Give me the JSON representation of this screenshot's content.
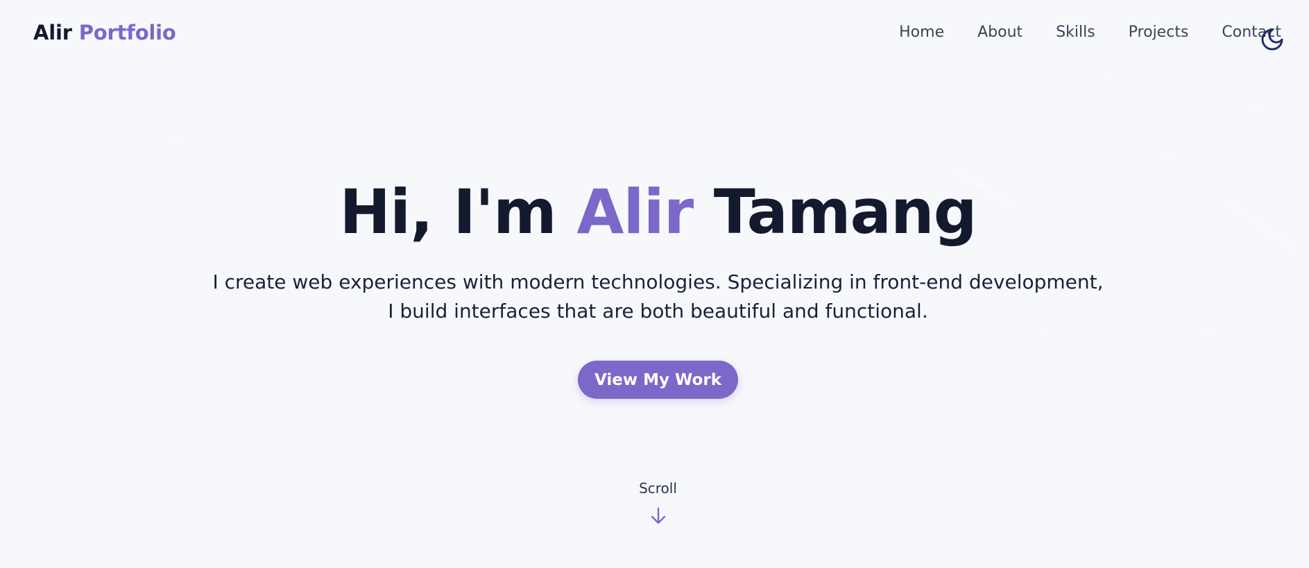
{
  "header": {
    "logo_main": "Alir",
    "logo_accent": "Portfolio",
    "nav": [
      "Home",
      "About",
      "Skills",
      "Projects",
      "Contact"
    ],
    "theme_toggle_icon": "moon-icon"
  },
  "hero": {
    "title_prefix": "Hi, I'm",
    "title_accent": "Alir",
    "title_suffix": "Tamang",
    "subtitle": "I create web experiences with modern technologies. Specializing in front-end development, I build interfaces that are both beautiful and functional.",
    "cta_label": "View My Work"
  },
  "scroll": {
    "label": "Scroll",
    "icon": "arrow-down-icon"
  },
  "colors": {
    "accent": "#7b68c8",
    "text": "#141a2e",
    "background": "#f7f8fc",
    "toggle": "#1f2f6b"
  }
}
